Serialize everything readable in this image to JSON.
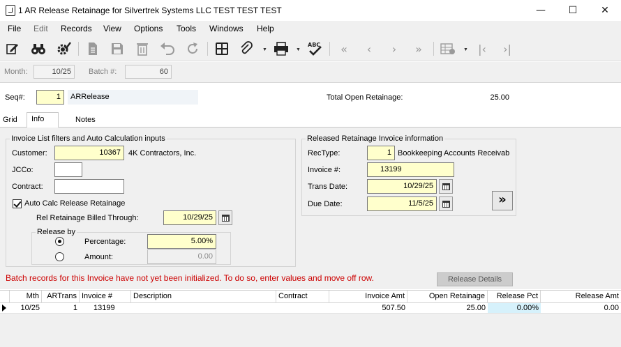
{
  "window": {
    "title": "1 AR Release Retainage for Silvertrek Systems LLC TEST TEST TEST",
    "minimize_glyph": "—",
    "maximize_glyph": "☐",
    "close_glyph": "✕"
  },
  "menu": {
    "file": "File",
    "edit": "Edit",
    "records": "Records",
    "view": "View",
    "options": "Options",
    "tools": "Tools",
    "windows": "Windows",
    "help": "Help"
  },
  "toolbar": {
    "icons": [
      "edit-icon",
      "binoculars-icon",
      "gear-check-icon",
      "document-icon",
      "save-icon",
      "delete-icon",
      "undo-icon",
      "refresh-icon",
      "calculator-icon",
      "attachment-icon",
      "printer-icon",
      "spellcheck-icon",
      "first-record-icon",
      "previous-record-icon",
      "next-record-icon",
      "last-record-icon",
      "grid-settings-icon",
      "first-icon",
      "last-icon"
    ]
  },
  "batch": {
    "month_label": "Month:",
    "month_value": "10/25",
    "batch_label": "Batch #:",
    "batch_value": "60"
  },
  "header": {
    "seq_label": "Seq#:",
    "seq_value": "1",
    "seq_desc": "ARRelease",
    "total_label": "Total Open Retainage:",
    "total_value": "25.00"
  },
  "tabs": {
    "grid": "Grid",
    "info": "Info",
    "notes": "Notes"
  },
  "filters": {
    "group_title": "Invoice List filters and Auto Calculation inputs",
    "customer_label": "Customer:",
    "customer_value": "10367",
    "customer_name": "4K Contractors, Inc.",
    "jcco_label": "JCCo:",
    "jcco_value": "",
    "contract_label": "Contract:",
    "contract_value": "",
    "auto_calc_label": "Auto Calc Release Retainage",
    "rel_billed_label": "Rel Retainage Billed Through:",
    "rel_billed_value": "10/29/25",
    "release_by_title": "Release by",
    "percentage_label": "Percentage:",
    "percentage_value": "5.00%",
    "amount_label": "Amount:",
    "amount_value": "0.00"
  },
  "released": {
    "group_title": "Released Retainage Invoice information",
    "rectype_label": "RecType:",
    "rectype_value": "1",
    "rectype_desc": "Bookkeeping Accounts Receivabl",
    "invoice_label": "Invoice #:",
    "invoice_value": "13199",
    "trans_date_label": "Trans Date:",
    "trans_date_value": "10/29/25",
    "due_date_label": "Due Date:",
    "due_date_value": "11/5/25",
    "go_glyph": "»"
  },
  "message": "Batch records for this Invoice have not yet been initialized.  To do so, enter values and move off row.",
  "release_details_button": "Release Details",
  "grid": {
    "columns": [
      "Mth",
      "ARTrans",
      "Invoice #",
      "Description",
      "Contract",
      "Invoice Amt",
      "Open Retainage",
      "Release Pct",
      "Release Amt"
    ],
    "rows": [
      [
        "10/25",
        "1",
        "13199",
        "",
        "",
        "507.50",
        "25.00",
        "0.00%",
        "0.00"
      ]
    ]
  },
  "colors": {
    "yellow_field": "#ffffcc",
    "error_text": "#cc0000",
    "selected_cell": "#d6f1fb"
  }
}
